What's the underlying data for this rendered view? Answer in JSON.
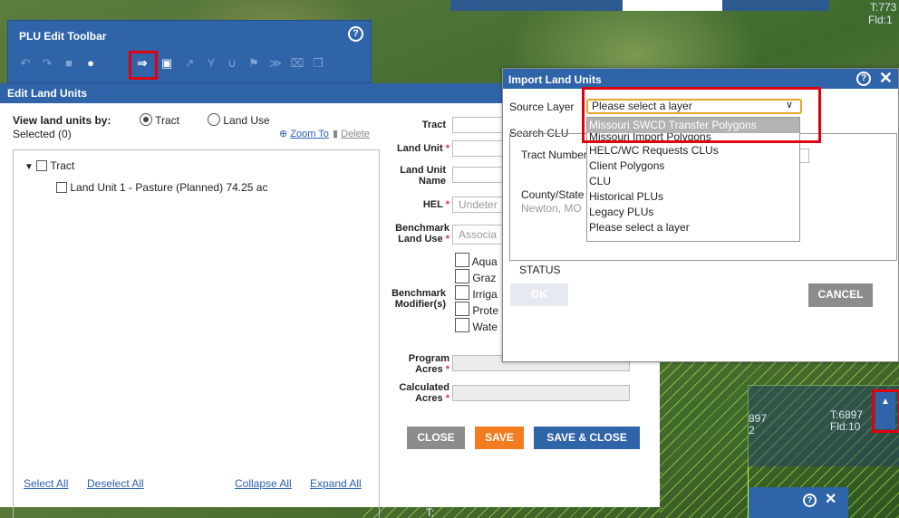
{
  "map": {
    "labels": [
      "T:773",
      "Fld:1",
      "T:6897",
      "Fld:10",
      "897",
      "2",
      "T:"
    ]
  },
  "plu_toolbar": {
    "title": "PLU Edit Toolbar",
    "help": "?",
    "tools": [
      "undo-icon",
      "redo-icon",
      "delete-icon",
      "select-parcel-icon",
      "import-icon",
      "rectangle-icon",
      "split-icon",
      "merge-icon",
      "reshape-icon",
      "pin-icon",
      "chevrons-icon",
      "close-tools-icon",
      "copy-icon"
    ]
  },
  "edit_panel": {
    "title": "Edit Land Units",
    "view_by_label": "View land units by:",
    "radio_tract": "Tract",
    "radio_land_use": "Land Use",
    "selected": "Selected (0)",
    "zoom_to": "Zoom To",
    "delete": "Delete",
    "tree_root": "Tract",
    "tree_item": "Land Unit 1 - Pasture (Planned) 74.25 ac",
    "select_all": "Select All",
    "deselect_all": "Deselect All",
    "collapse_all": "Collapse All",
    "expand_all": "Expand All",
    "form": {
      "tract": "Tract",
      "land_unit": "Land Unit",
      "land_unit_name_1": "Land Unit",
      "land_unit_name_2": "Name",
      "hel": "HEL",
      "hel_value": "Undeter",
      "benchmark_land_use_1": "Benchmark",
      "benchmark_land_use_2": "Land Use",
      "benchmark_land_use_value": "Associa",
      "benchmark_modifiers_1": "Benchmark",
      "benchmark_modifiers_2": "Modifier(s)",
      "modifiers": [
        "Aqua",
        "Graz",
        "Irriga",
        "Prote",
        "Wate"
      ],
      "program_acres_1": "Program",
      "program_acres_2": "Acres",
      "calculated_acres_1": "Calculated",
      "calculated_acres_2": "Acres",
      "required_mark": "*"
    },
    "buttons": {
      "close": "CLOSE",
      "save": "SAVE",
      "save_close": "SAVE & CLOSE"
    }
  },
  "import_dialog": {
    "title": "Import Land Units",
    "help": "?",
    "close": "✕",
    "source_layer_label": "Source Layer",
    "source_layer_value": "Please select a layer",
    "search_label": "Search CLU",
    "tract_number_label": "Tract Number",
    "county_state_label": "County/State",
    "county_state_value": "Newton, MO",
    "status_label": "STATUS",
    "ok": "OK",
    "cancel": "CANCEL",
    "options": [
      "Missouri SWCD Transfer Polygons",
      "Missouri Import Polygons",
      "HELC/WC Requests CLUs",
      "Client Polygons",
      "CLU",
      "Historical PLUs",
      "Legacy PLUs",
      "Please select a layer"
    ]
  },
  "colors": {
    "panel_blue": "#2f64a8",
    "save_orange": "#f47c20",
    "highlight_red": "#e0000f",
    "dropdown_border": "#e8a423"
  }
}
